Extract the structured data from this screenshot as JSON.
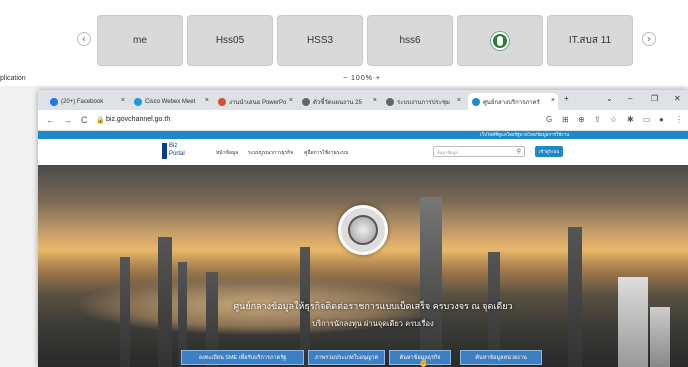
{
  "participants": {
    "prev_label": "‹",
    "next_label": "›",
    "tiles": [
      {
        "label": "me"
      },
      {
        "label": "Hss05"
      },
      {
        "label": "HSS3"
      },
      {
        "label": "hss6"
      },
      {
        "label": ""
      },
      {
        "label": "IT.สบส 11"
      }
    ]
  },
  "toolbar": {
    "app_label": "plication",
    "zoom_label": "−  100%  +"
  },
  "browser": {
    "tabs": [
      {
        "label": "(20+) Facebook",
        "color": "#1877f2"
      },
      {
        "label": "Cisco Webex Meet",
        "color": "#1b9ad6"
      },
      {
        "label": "งานนำเสนอ PowerPo",
        "color": "#d35230"
      },
      {
        "label": "ตัวชี้วัดแผนงาน 25",
        "color": "#666666"
      },
      {
        "label": "ระบบงานการประชุม",
        "color": "#666666"
      },
      {
        "label": "ศูนย์กลางบริการภาครั",
        "color": "#1e88c8"
      }
    ],
    "new_tab": "+",
    "window_controls": [
      "⌄",
      "–",
      "❐",
      "✕"
    ],
    "url": "biz.govchannel.go.th",
    "nav": [
      "←",
      "→",
      "C"
    ]
  },
  "site": {
    "top_notice": "เว็บไซต์ที่ดูแลโดยรัฐบาลไทย/ข้อมูลการใช้งาน",
    "logo_line1": "Biz",
    "logo_line2": "Portal",
    "menu": [
      "หน้าข้อมูล",
      "ระบบบูรณาการธุรกิจ",
      "คู่มือการใช้งานระบบ"
    ],
    "search_placeholder": "ค้นหาข้อมูล",
    "login_label": "เข้าสู่ระบบ",
    "headline": "ศูนย์กลางข้อมูลให้ธุรกิจติดต่อราชการแบบเบ็ดเสร็จ ครบวงจร ณ จุดเดียว",
    "subline": "บริการนักลงทุน ผ่านจุดเดียว ครบเรื่อง",
    "buttons": [
      "ลงทะเบียน SME เพื่อรับบริการภาครัฐ",
      "ภาพรวมประเภทใบอนุญาต",
      "ค้นหาข้อมูลธุรกิจ",
      "ค้นหาข้อมูลหน่วยงาน"
    ]
  }
}
